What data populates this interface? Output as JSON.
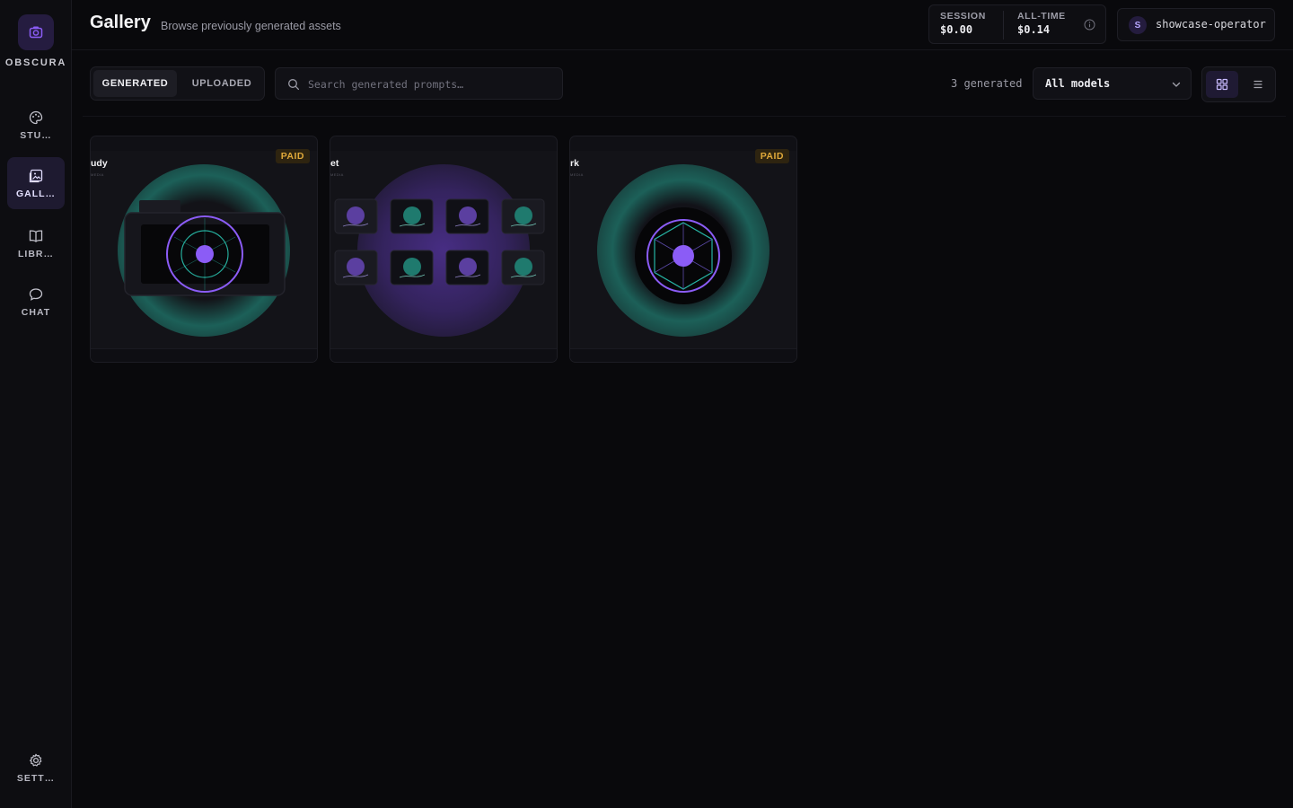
{
  "app": {
    "name": "OBSCURA"
  },
  "sidebar": {
    "items": [
      {
        "label": "STU…",
        "icon": "palette-icon",
        "active": false
      },
      {
        "label": "GALL…",
        "icon": "gallery-icon",
        "active": true
      },
      {
        "label": "LIBR…",
        "icon": "book-icon",
        "active": false
      },
      {
        "label": "CHAT",
        "icon": "chat-bubble-icon",
        "active": false
      }
    ],
    "settings": {
      "label": "SETT…",
      "icon": "gear-icon"
    }
  },
  "header": {
    "title": "Gallery",
    "subtitle": "Browse previously generated assets",
    "session": {
      "label": "SESSION",
      "value": "$0.00"
    },
    "alltime": {
      "label": "ALL-TIME",
      "value": "$0.14"
    },
    "user": {
      "initial": "S",
      "name": "showcase-operator"
    }
  },
  "toolbar": {
    "tabs": [
      {
        "label": "GENERATED",
        "active": true
      },
      {
        "label": "UPLOADED",
        "active": false
      }
    ],
    "search_placeholder": "Search generated prompts…",
    "count": "3 generated",
    "model_filter": "All models",
    "view_mode": "grid"
  },
  "cards": [
    {
      "title": "udy",
      "subtitle": "MEDIA",
      "badge": "PAID",
      "art": "camera"
    },
    {
      "title": "et",
      "subtitle": "MEDIA",
      "badge": "",
      "art": "grid"
    },
    {
      "title": "rk",
      "subtitle": "MEDIA",
      "badge": "PAID",
      "art": "aperture"
    }
  ],
  "colors": {
    "accent": "#8b5cf6",
    "teal": "#2dd4bf",
    "paid": "#e0a93a",
    "background": "#09090c"
  }
}
